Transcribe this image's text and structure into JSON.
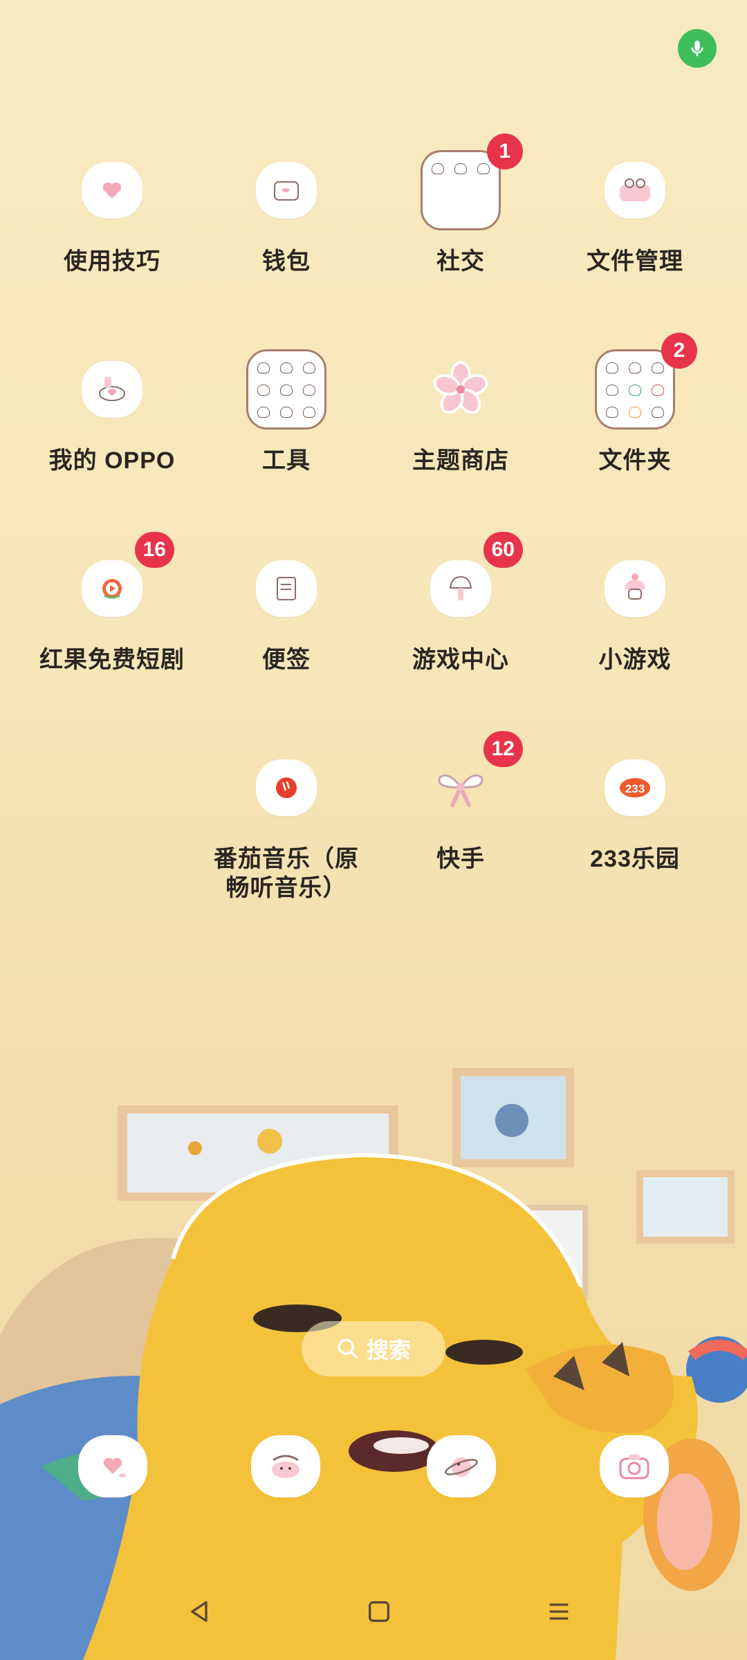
{
  "apps": [
    {
      "label": "使用技巧",
      "icon": "tips-icon",
      "badge": ""
    },
    {
      "label": "钱包",
      "icon": "wallet-icon",
      "badge": ""
    },
    {
      "label": "社交",
      "icon": "social-folder-icon",
      "badge": "1"
    },
    {
      "label": "文件管理",
      "icon": "file-manager-icon",
      "badge": ""
    },
    {
      "label": "我的 OPPO",
      "icon": "my-oppo-icon",
      "badge": ""
    },
    {
      "label": "工具",
      "icon": "tools-folder-icon",
      "badge": ""
    },
    {
      "label": "主题商店",
      "icon": "theme-store-icon",
      "badge": ""
    },
    {
      "label": "文件夹",
      "icon": "folder-icon",
      "badge": "2"
    },
    {
      "label": "红果免费短剧",
      "icon": "hongguo-icon",
      "badge": "16"
    },
    {
      "label": "便签",
      "icon": "notes-icon",
      "badge": ""
    },
    {
      "label": "游戏中心",
      "icon": "game-center-icon",
      "badge": "60"
    },
    {
      "label": "小游戏",
      "icon": "mini-games-icon",
      "badge": ""
    },
    {
      "label": "番茄音乐（原\n畅听音乐）",
      "icon": "tomato-music-icon",
      "badge": ""
    },
    {
      "label": "快手",
      "icon": "kuaishou-icon",
      "badge": "12"
    },
    {
      "label": "233乐园",
      "icon": "233-park-icon",
      "badge": ""
    }
  ],
  "search": {
    "label": "搜索"
  },
  "dock": [
    {
      "icon": "messages-icon"
    },
    {
      "icon": "phone-icon"
    },
    {
      "icon": "browser-icon"
    },
    {
      "icon": "camera-icon"
    }
  ],
  "nav": [
    "back-icon",
    "home-icon",
    "recents-icon"
  ],
  "colors": {
    "badge": "#e8344a",
    "mic": "#3dbe5b",
    "label": "#2a2522"
  }
}
